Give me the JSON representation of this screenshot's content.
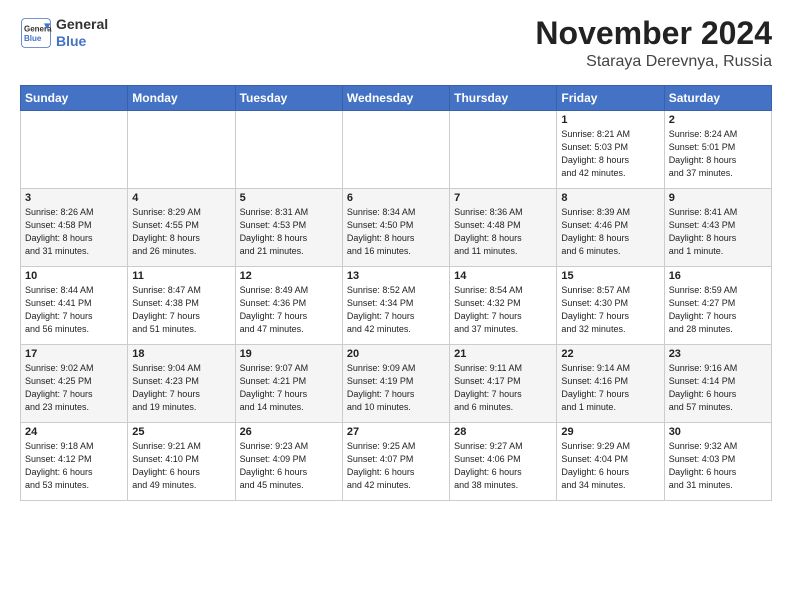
{
  "logo": {
    "line1": "General",
    "line2": "Blue"
  },
  "title": "November 2024",
  "location": "Staraya Derevnya, Russia",
  "headers": [
    "Sunday",
    "Monday",
    "Tuesday",
    "Wednesday",
    "Thursday",
    "Friday",
    "Saturday"
  ],
  "weeks": [
    [
      {
        "day": "",
        "info": ""
      },
      {
        "day": "",
        "info": ""
      },
      {
        "day": "",
        "info": ""
      },
      {
        "day": "",
        "info": ""
      },
      {
        "day": "",
        "info": ""
      },
      {
        "day": "1",
        "info": "Sunrise: 8:21 AM\nSunset: 5:03 PM\nDaylight: 8 hours\nand 42 minutes."
      },
      {
        "day": "2",
        "info": "Sunrise: 8:24 AM\nSunset: 5:01 PM\nDaylight: 8 hours\nand 37 minutes."
      }
    ],
    [
      {
        "day": "3",
        "info": "Sunrise: 8:26 AM\nSunset: 4:58 PM\nDaylight: 8 hours\nand 31 minutes."
      },
      {
        "day": "4",
        "info": "Sunrise: 8:29 AM\nSunset: 4:55 PM\nDaylight: 8 hours\nand 26 minutes."
      },
      {
        "day": "5",
        "info": "Sunrise: 8:31 AM\nSunset: 4:53 PM\nDaylight: 8 hours\nand 21 minutes."
      },
      {
        "day": "6",
        "info": "Sunrise: 8:34 AM\nSunset: 4:50 PM\nDaylight: 8 hours\nand 16 minutes."
      },
      {
        "day": "7",
        "info": "Sunrise: 8:36 AM\nSunset: 4:48 PM\nDaylight: 8 hours\nand 11 minutes."
      },
      {
        "day": "8",
        "info": "Sunrise: 8:39 AM\nSunset: 4:46 PM\nDaylight: 8 hours\nand 6 minutes."
      },
      {
        "day": "9",
        "info": "Sunrise: 8:41 AM\nSunset: 4:43 PM\nDaylight: 8 hours\nand 1 minute."
      }
    ],
    [
      {
        "day": "10",
        "info": "Sunrise: 8:44 AM\nSunset: 4:41 PM\nDaylight: 7 hours\nand 56 minutes."
      },
      {
        "day": "11",
        "info": "Sunrise: 8:47 AM\nSunset: 4:38 PM\nDaylight: 7 hours\nand 51 minutes."
      },
      {
        "day": "12",
        "info": "Sunrise: 8:49 AM\nSunset: 4:36 PM\nDaylight: 7 hours\nand 47 minutes."
      },
      {
        "day": "13",
        "info": "Sunrise: 8:52 AM\nSunset: 4:34 PM\nDaylight: 7 hours\nand 42 minutes."
      },
      {
        "day": "14",
        "info": "Sunrise: 8:54 AM\nSunset: 4:32 PM\nDaylight: 7 hours\nand 37 minutes."
      },
      {
        "day": "15",
        "info": "Sunrise: 8:57 AM\nSunset: 4:30 PM\nDaylight: 7 hours\nand 32 minutes."
      },
      {
        "day": "16",
        "info": "Sunrise: 8:59 AM\nSunset: 4:27 PM\nDaylight: 7 hours\nand 28 minutes."
      }
    ],
    [
      {
        "day": "17",
        "info": "Sunrise: 9:02 AM\nSunset: 4:25 PM\nDaylight: 7 hours\nand 23 minutes."
      },
      {
        "day": "18",
        "info": "Sunrise: 9:04 AM\nSunset: 4:23 PM\nDaylight: 7 hours\nand 19 minutes."
      },
      {
        "day": "19",
        "info": "Sunrise: 9:07 AM\nSunset: 4:21 PM\nDaylight: 7 hours\nand 14 minutes."
      },
      {
        "day": "20",
        "info": "Sunrise: 9:09 AM\nSunset: 4:19 PM\nDaylight: 7 hours\nand 10 minutes."
      },
      {
        "day": "21",
        "info": "Sunrise: 9:11 AM\nSunset: 4:17 PM\nDaylight: 7 hours\nand 6 minutes."
      },
      {
        "day": "22",
        "info": "Sunrise: 9:14 AM\nSunset: 4:16 PM\nDaylight: 7 hours\nand 1 minute."
      },
      {
        "day": "23",
        "info": "Sunrise: 9:16 AM\nSunset: 4:14 PM\nDaylight: 6 hours\nand 57 minutes."
      }
    ],
    [
      {
        "day": "24",
        "info": "Sunrise: 9:18 AM\nSunset: 4:12 PM\nDaylight: 6 hours\nand 53 minutes."
      },
      {
        "day": "25",
        "info": "Sunrise: 9:21 AM\nSunset: 4:10 PM\nDaylight: 6 hours\nand 49 minutes."
      },
      {
        "day": "26",
        "info": "Sunrise: 9:23 AM\nSunset: 4:09 PM\nDaylight: 6 hours\nand 45 minutes."
      },
      {
        "day": "27",
        "info": "Sunrise: 9:25 AM\nSunset: 4:07 PM\nDaylight: 6 hours\nand 42 minutes."
      },
      {
        "day": "28",
        "info": "Sunrise: 9:27 AM\nSunset: 4:06 PM\nDaylight: 6 hours\nand 38 minutes."
      },
      {
        "day": "29",
        "info": "Sunrise: 9:29 AM\nSunset: 4:04 PM\nDaylight: 6 hours\nand 34 minutes."
      },
      {
        "day": "30",
        "info": "Sunrise: 9:32 AM\nSunset: 4:03 PM\nDaylight: 6 hours\nand 31 minutes."
      }
    ]
  ]
}
